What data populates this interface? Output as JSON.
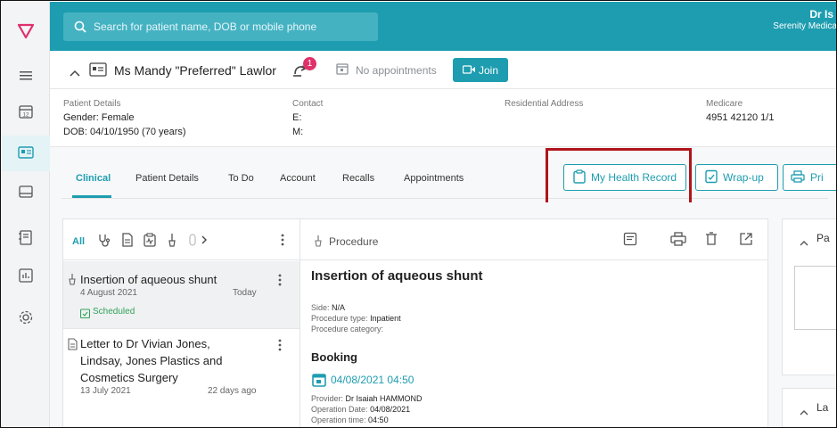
{
  "app": {
    "accent": "#1e9db0",
    "alert_red": "#b0141b"
  },
  "topbar": {
    "search_placeholder": "Search for patient name, DOB or mobile phone",
    "doctor_name": "Dr Is",
    "practice_name": "Serenity Medica"
  },
  "patient_bar": {
    "name": "Ms Mandy \"Preferred\" Lawlor",
    "notification_count": "1",
    "appointment_status": "No appointments",
    "join_label": "Join"
  },
  "details": {
    "patient_details_heading": "Patient Details",
    "gender": "Gender: Female",
    "dob": "DOB: 04/10/1950 (70 years)",
    "contact_heading": "Contact",
    "email": "E:",
    "mobile": "M:",
    "address_heading": "Residential Address",
    "medicare_heading": "Medicare",
    "medicare_number": "4951 42120 1/1"
  },
  "tabs": [
    "Clinical",
    "Patient Details",
    "To Do",
    "Account",
    "Recalls",
    "Appointments"
  ],
  "actions": {
    "my_health_record": "My Health Record",
    "wrap_up": "Wrap-up",
    "print": "Pri"
  },
  "filter": {
    "all_label": "All"
  },
  "list_items": [
    {
      "title": "Insertion of aqueous shunt",
      "date": "4 August 2021",
      "relative": "Today",
      "status": "Scheduled"
    },
    {
      "title_lines": [
        "Letter to Dr Vivian Jones,",
        "Lindsay, Jones Plastics and",
        "Cosmetics Surgery"
      ],
      "date": "13 July 2021",
      "relative": "22 days ago"
    }
  ],
  "detail": {
    "header": "Procedure",
    "title": "Insertion of aqueous shunt",
    "side_label": "Side:",
    "side_value": "N/A",
    "type_label": "Procedure type:",
    "type_value": "Inpatient",
    "category_label": "Procedure category:",
    "booking_heading": "Booking",
    "booking_datetime": "04/08/2021 04:50",
    "provider_label": "Provider:",
    "provider_value": "Dr Isaiah HAMMOND",
    "op_date_label": "Operation Date:",
    "op_date_value": "04/08/2021",
    "op_time_label": "Operation time:",
    "op_time_value": "04:50"
  },
  "far_panels": {
    "top_label": "Pa",
    "bottom_label": "La"
  }
}
